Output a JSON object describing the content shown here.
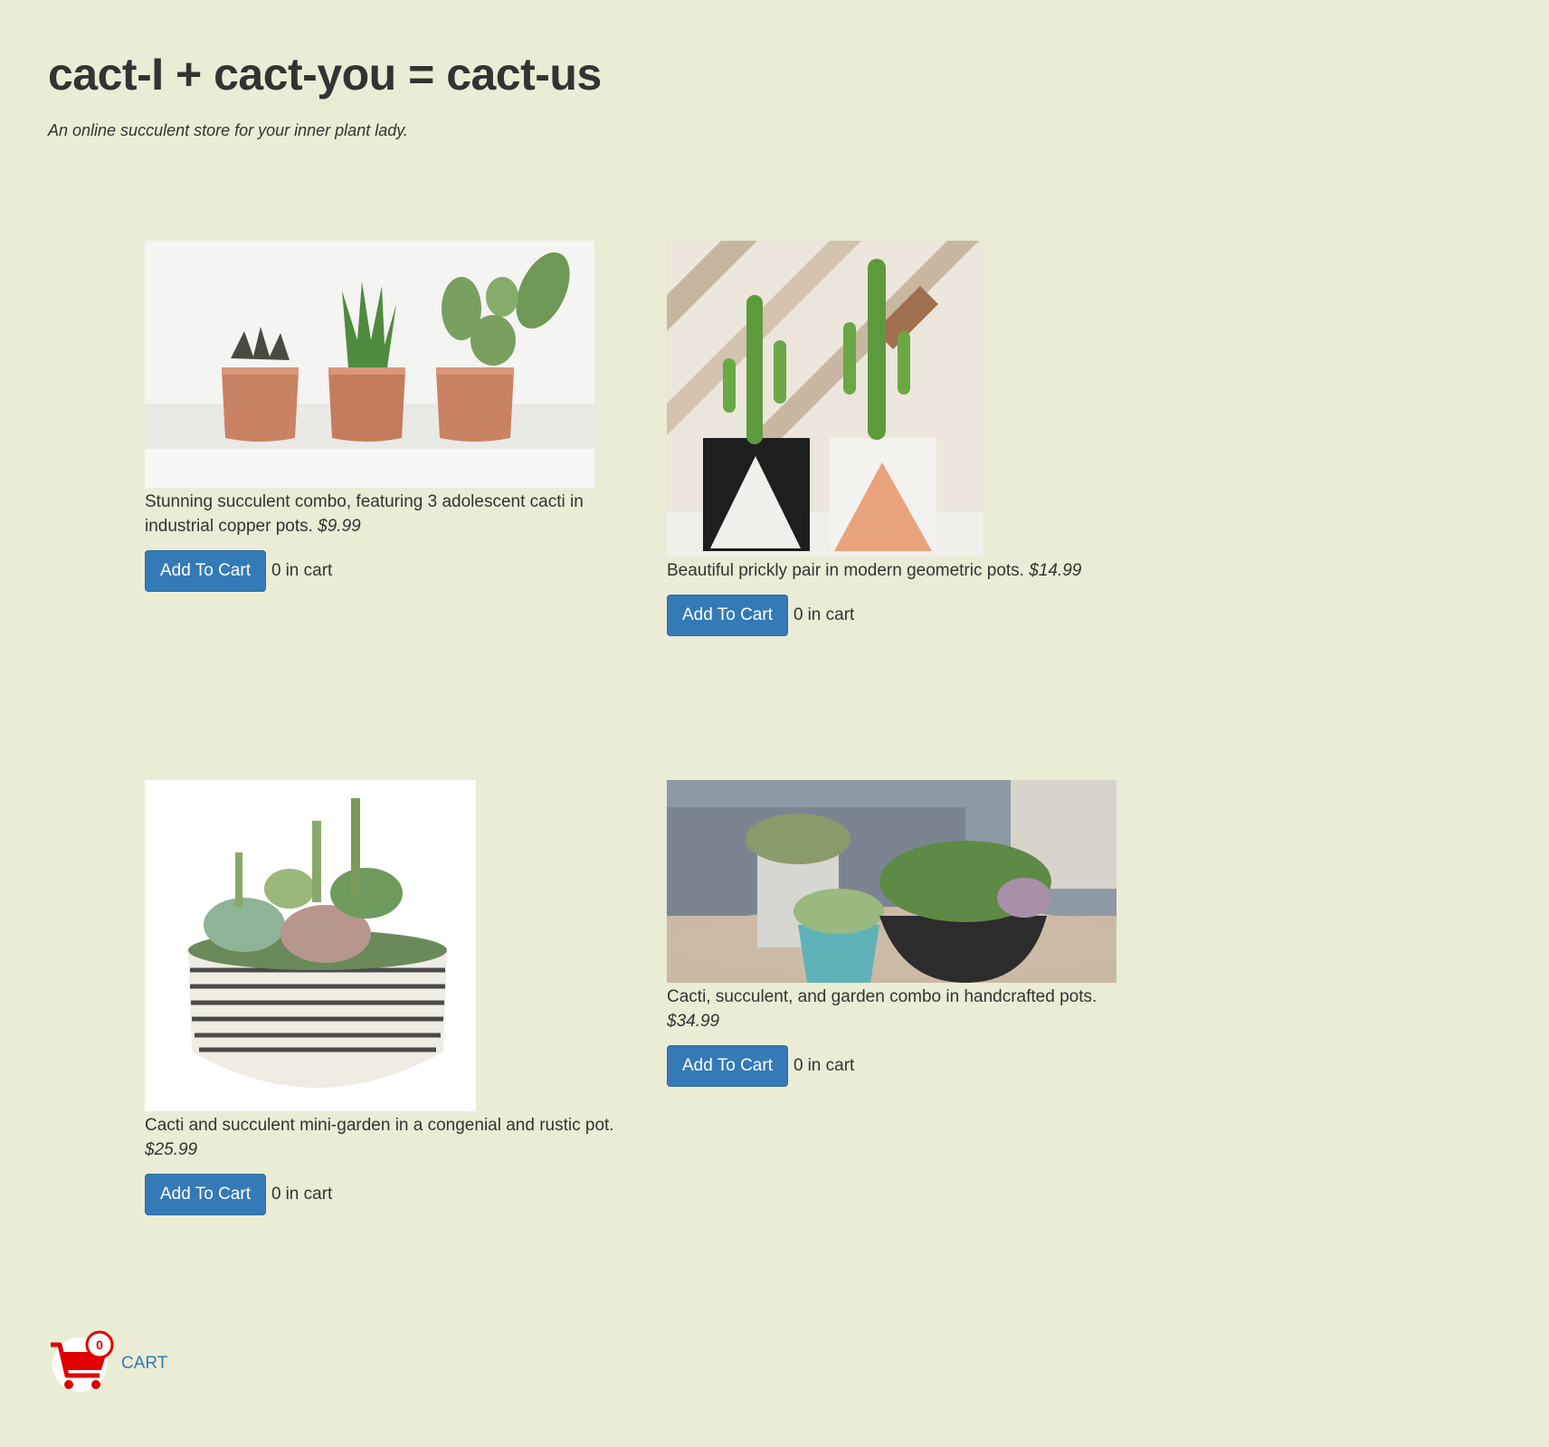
{
  "header": {
    "title": "cact-I + cact-you = cact-us",
    "tagline": "An online succulent store for your inner plant lady."
  },
  "products": [
    {
      "description": "Stunning succulent combo, featuring 3 adolescent cacti in industrial copper pots.",
      "price": "$9.99",
      "button_label": "Add To Cart",
      "count": "0",
      "count_suffix": "in cart",
      "image_icon": "copper-pots-cacti-photo"
    },
    {
      "description": "Beautiful prickly pair in modern geometric pots.",
      "price": "$14.99",
      "button_label": "Add To Cart",
      "count": "0",
      "count_suffix": "in cart",
      "image_icon": "geometric-pots-cacti-photo"
    },
    {
      "description": "Cacti and succulent mini-garden in a congenial and rustic pot.",
      "price": "$25.99",
      "button_label": "Add To Cart",
      "count": "0",
      "count_suffix": "in cart",
      "image_icon": "striped-bowl-succulents-photo"
    },
    {
      "description": "Cacti, succulent, and garden combo in handcrafted pots.",
      "price": "$34.99",
      "button_label": "Add To Cart",
      "count": "0",
      "count_suffix": "in cart",
      "image_icon": "handcrafted-pots-succulents-photo"
    }
  ],
  "cart": {
    "label": "CART",
    "badge_count": "0",
    "icon": "shopping-cart-icon"
  },
  "colors": {
    "background": "#ebecd5",
    "button": "#337ab7",
    "cart_red": "#e00000",
    "link": "#337ab7"
  }
}
